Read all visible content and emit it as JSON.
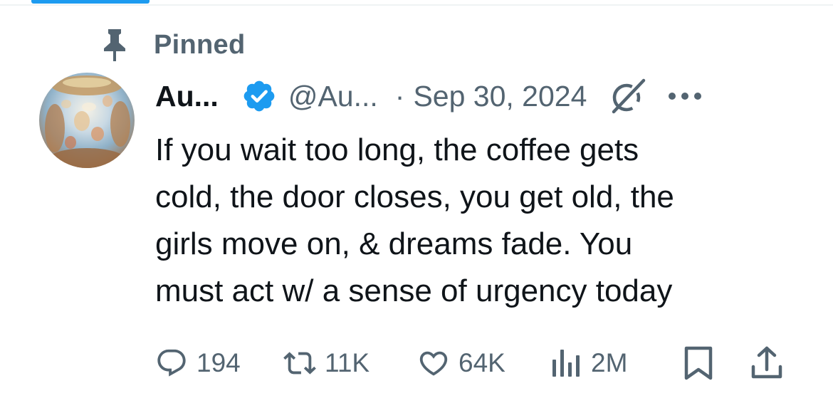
{
  "pinned": {
    "label": "Pinned"
  },
  "tweet": {
    "display_name": "Au...",
    "handle": "@Au...",
    "separator": "·",
    "date": "Sep 30, 2024",
    "text": "If you wait too long, the coffee gets\ncold, the door closes, you get old, the\ngirls move on, & dreams fade. You\nmust act w/ a sense of urgency today",
    "verified": true
  },
  "actions": {
    "replies": "194",
    "reposts": "11K",
    "likes": "64K",
    "views": "2M"
  },
  "icons": {
    "pin": "pin-icon",
    "verified": "verified-badge-icon",
    "grok": "grok-icon",
    "more": "more-dots-icon",
    "reply": "reply-icon",
    "repost": "repost-icon",
    "like": "heart-icon",
    "views": "views-chart-icon",
    "bookmark": "bookmark-icon",
    "share": "share-icon"
  },
  "colors": {
    "accent": "#1d9bf0",
    "secondary_text": "#536471",
    "primary_text": "#0f1419"
  }
}
